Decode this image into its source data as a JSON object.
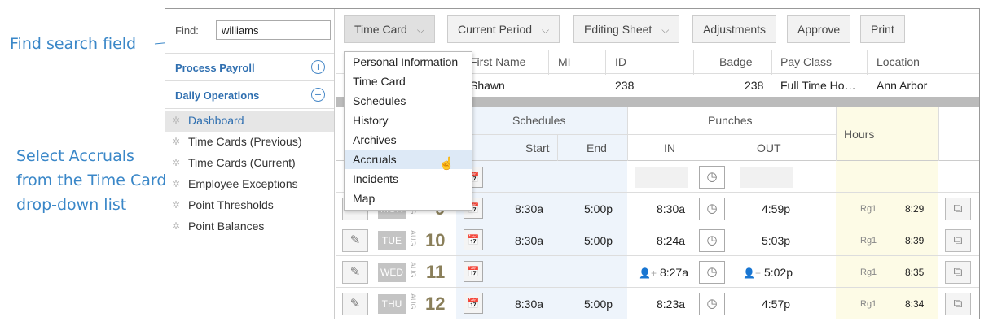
{
  "callouts": {
    "find": "Find search field",
    "accruals": "Select Accruals from the Time Card drop-down list"
  },
  "find": {
    "label": "Find:",
    "value": "williams"
  },
  "sidebar": {
    "sections": [
      {
        "label": "Process Payroll",
        "toggle": "+"
      },
      {
        "label": "Daily Operations",
        "toggle": "−"
      }
    ],
    "items": [
      {
        "label": "Dashboard"
      },
      {
        "label": "Time Cards (Previous)"
      },
      {
        "label": "Time Cards (Current)"
      },
      {
        "label": "Employee Exceptions"
      },
      {
        "label": "Point Thresholds"
      },
      {
        "label": "Point Balances"
      }
    ]
  },
  "toolbar": {
    "time_card": "Time Card",
    "current_period": "Current Period",
    "editing_sheet": "Editing Sheet",
    "adjustments": "Adjustments",
    "approve": "Approve",
    "print": "Print"
  },
  "dropdown": {
    "items": [
      "Personal Information",
      "Time Card",
      "Schedules",
      "History",
      "Archives",
      "Accruals",
      "Incidents",
      "Map"
    ],
    "highlighted": "Accruals"
  },
  "employee": {
    "headers": {
      "first_name": "First Name",
      "mi": "MI",
      "id": "ID",
      "badge": "Badge",
      "pay_class": "Pay Class",
      "location": "Location"
    },
    "row": {
      "first_name": "Shawn",
      "mi": "",
      "id": "238",
      "badge": "238",
      "pay_class": "Full Time Ho…",
      "location": "Ann Arbor"
    }
  },
  "grid": {
    "headers": {
      "schedules": "Schedules",
      "start": "Start",
      "end": "End",
      "punches": "Punches",
      "in": "IN",
      "out": "OUT",
      "hours": "Hours"
    },
    "rows": [
      {
        "dow": "MON",
        "month": "AUG",
        "day": "9",
        "start": "8:30a",
        "end": "5:00p",
        "in": "8:30a",
        "out": "4:59p",
        "code": "Rg1",
        "hours": "8:29"
      },
      {
        "dow": "TUE",
        "month": "AUG",
        "day": "10",
        "start": "8:30a",
        "end": "5:00p",
        "in": "8:24a",
        "out": "5:03p",
        "code": "Rg1",
        "hours": "8:39"
      },
      {
        "dow": "WED",
        "month": "AUG",
        "day": "11",
        "start": "",
        "end": "",
        "in": "8:27a",
        "out": "5:02p",
        "code": "Rg1",
        "hours": "8:35"
      },
      {
        "dow": "THU",
        "month": "AUG",
        "day": "12",
        "start": "8:30a",
        "end": "5:00p",
        "in": "8:23a",
        "out": "4:57p",
        "code": "Rg1",
        "hours": "8:34"
      }
    ]
  },
  "colors": {
    "callout": "#3a87c8",
    "link": "#2f6fb0",
    "highlight": "#dde9f6"
  }
}
